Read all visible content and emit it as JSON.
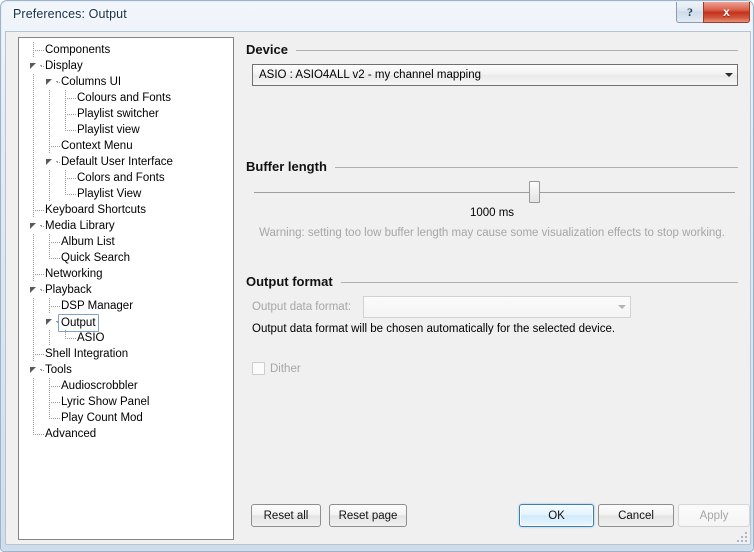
{
  "window": {
    "title": "Preferences: Output",
    "help_button": "?",
    "close_button": "x"
  },
  "tree": {
    "items": [
      {
        "label": "Components",
        "depth": 0,
        "expander": "none",
        "selected": false
      },
      {
        "label": "Display",
        "depth": 0,
        "expander": "expanded",
        "selected": false
      },
      {
        "label": "Columns UI",
        "depth": 1,
        "expander": "expanded",
        "selected": false
      },
      {
        "label": "Colours and Fonts",
        "depth": 2,
        "expander": "none",
        "selected": false
      },
      {
        "label": "Playlist switcher",
        "depth": 2,
        "expander": "none",
        "selected": false
      },
      {
        "label": "Playlist view",
        "depth": 2,
        "expander": "none",
        "selected": false
      },
      {
        "label": "Context Menu",
        "depth": 1,
        "expander": "none",
        "selected": false
      },
      {
        "label": "Default User Interface",
        "depth": 1,
        "expander": "expanded",
        "selected": false
      },
      {
        "label": "Colors and Fonts",
        "depth": 2,
        "expander": "none",
        "selected": false
      },
      {
        "label": "Playlist View",
        "depth": 2,
        "expander": "none",
        "selected": false
      },
      {
        "label": "Keyboard Shortcuts",
        "depth": 0,
        "expander": "none",
        "selected": false
      },
      {
        "label": "Media Library",
        "depth": 0,
        "expander": "expanded",
        "selected": false
      },
      {
        "label": "Album List",
        "depth": 1,
        "expander": "none",
        "selected": false
      },
      {
        "label": "Quick Search",
        "depth": 1,
        "expander": "none",
        "selected": false
      },
      {
        "label": "Networking",
        "depth": 0,
        "expander": "none",
        "selected": false
      },
      {
        "label": "Playback",
        "depth": 0,
        "expander": "expanded",
        "selected": false
      },
      {
        "label": "DSP Manager",
        "depth": 1,
        "expander": "none",
        "selected": false
      },
      {
        "label": "Output",
        "depth": 1,
        "expander": "expanded",
        "selected": true
      },
      {
        "label": "ASIO",
        "depth": 2,
        "expander": "none",
        "selected": false
      },
      {
        "label": "Shell Integration",
        "depth": 0,
        "expander": "none",
        "selected": false
      },
      {
        "label": "Tools",
        "depth": 0,
        "expander": "expanded",
        "selected": false
      },
      {
        "label": "Audioscrobbler",
        "depth": 1,
        "expander": "none",
        "selected": false
      },
      {
        "label": "Lyric Show Panel",
        "depth": 1,
        "expander": "none",
        "selected": false
      },
      {
        "label": "Play Count Mod",
        "depth": 1,
        "expander": "none",
        "selected": false
      },
      {
        "label": "Advanced",
        "depth": 0,
        "expander": "none",
        "selected": false
      }
    ]
  },
  "device": {
    "group_title": "Device",
    "selected_value": "ASIO : ASIO4ALL v2 - my channel mapping"
  },
  "buffer": {
    "group_title": "Buffer length",
    "value_text": "1000 ms",
    "warning": "Warning: setting too low buffer length may cause some visualization effects to stop working."
  },
  "output_format": {
    "group_title": "Output format",
    "data_format_label": "Output data format:",
    "data_format_value": "",
    "note": "Output data format will be chosen automatically for the selected device.",
    "dither_label": "Dither"
  },
  "footer": {
    "reset_all": "Reset all",
    "reset_page": "Reset page",
    "ok": "OK",
    "cancel": "Cancel",
    "apply": "Apply"
  },
  "colors": {
    "window_background": "#f0f0f0",
    "tree_background": "#ffffff",
    "accent_default_button": "#3c7fb1",
    "close_button": "#c6321c",
    "disabled_text": "#a6a6a6"
  }
}
